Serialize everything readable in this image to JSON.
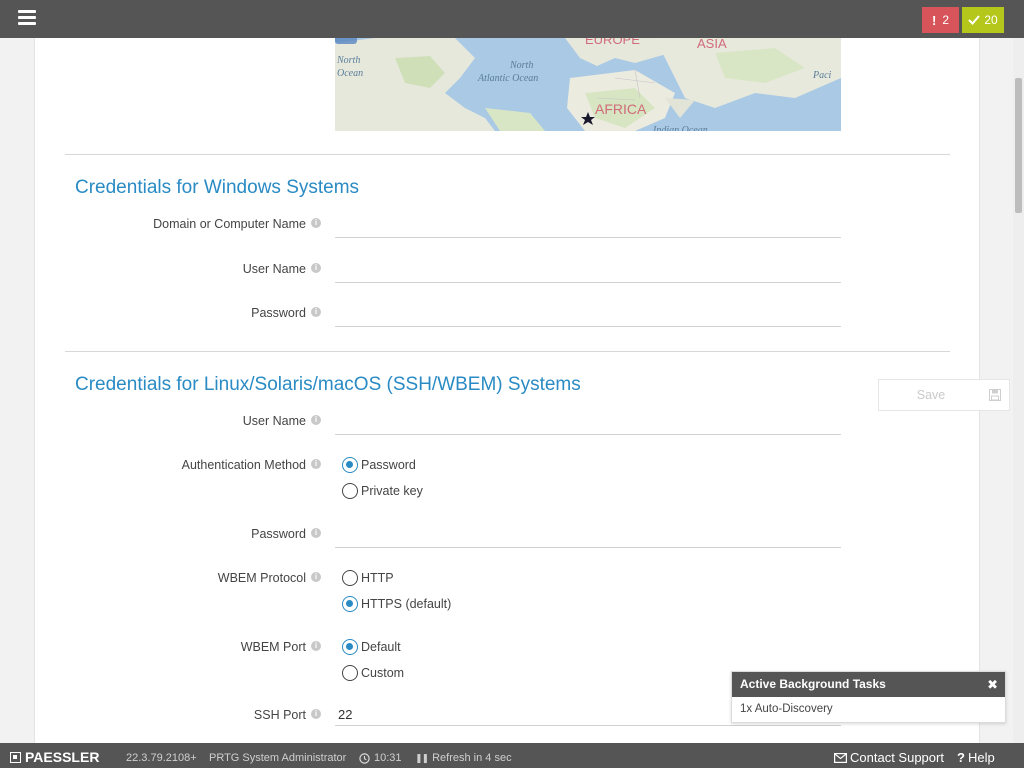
{
  "topbar": {
    "alarm_count": "2",
    "ok_count": "20",
    "colors": {
      "bar": "#555555",
      "alarm": "#d7555a",
      "ok": "#b4c71a"
    }
  },
  "map": {
    "labels": [
      "North Ocean",
      "North Atlantic Ocean",
      "ASIA",
      "AFRICA",
      "EUROPE",
      "Paci",
      "Indian Ocean"
    ]
  },
  "windows": {
    "title": "Credentials for Windows Systems",
    "domain_label": "Domain or Computer Name",
    "domain_value": "",
    "user_label": "User Name",
    "user_value": "",
    "password_label": "Password",
    "password_value": ""
  },
  "linux": {
    "title": "Credentials for Linux/Solaris/macOS (SSH/WBEM) Systems",
    "user_label": "User Name",
    "user_value": "",
    "auth_label": "Authentication Method",
    "auth_options": [
      "Password",
      "Private key"
    ],
    "auth_selected": "Password",
    "password_label": "Password",
    "password_value": "",
    "wbem_protocol_label": "WBEM Protocol",
    "wbem_protocol_options": [
      "HTTP",
      "HTTPS (default)"
    ],
    "wbem_protocol_selected": "HTTPS (default)",
    "wbem_port_label": "WBEM Port",
    "wbem_port_options": [
      "Default",
      "Custom"
    ],
    "wbem_port_selected": "Default",
    "ssh_port_label": "SSH Port",
    "ssh_port_value": "22"
  },
  "save": {
    "label": "Save"
  },
  "tasks": {
    "title": "Active Background Tasks",
    "item": "1x Auto-Discovery"
  },
  "footer": {
    "brand": "PAESSLER",
    "version": "22.3.79.2108+",
    "user": "PRTG System Administrator",
    "time": "10:31",
    "refresh": "Refresh in 4 sec",
    "contact": "Contact Support",
    "help": "Help"
  },
  "accent_color": "#2a8bc4"
}
